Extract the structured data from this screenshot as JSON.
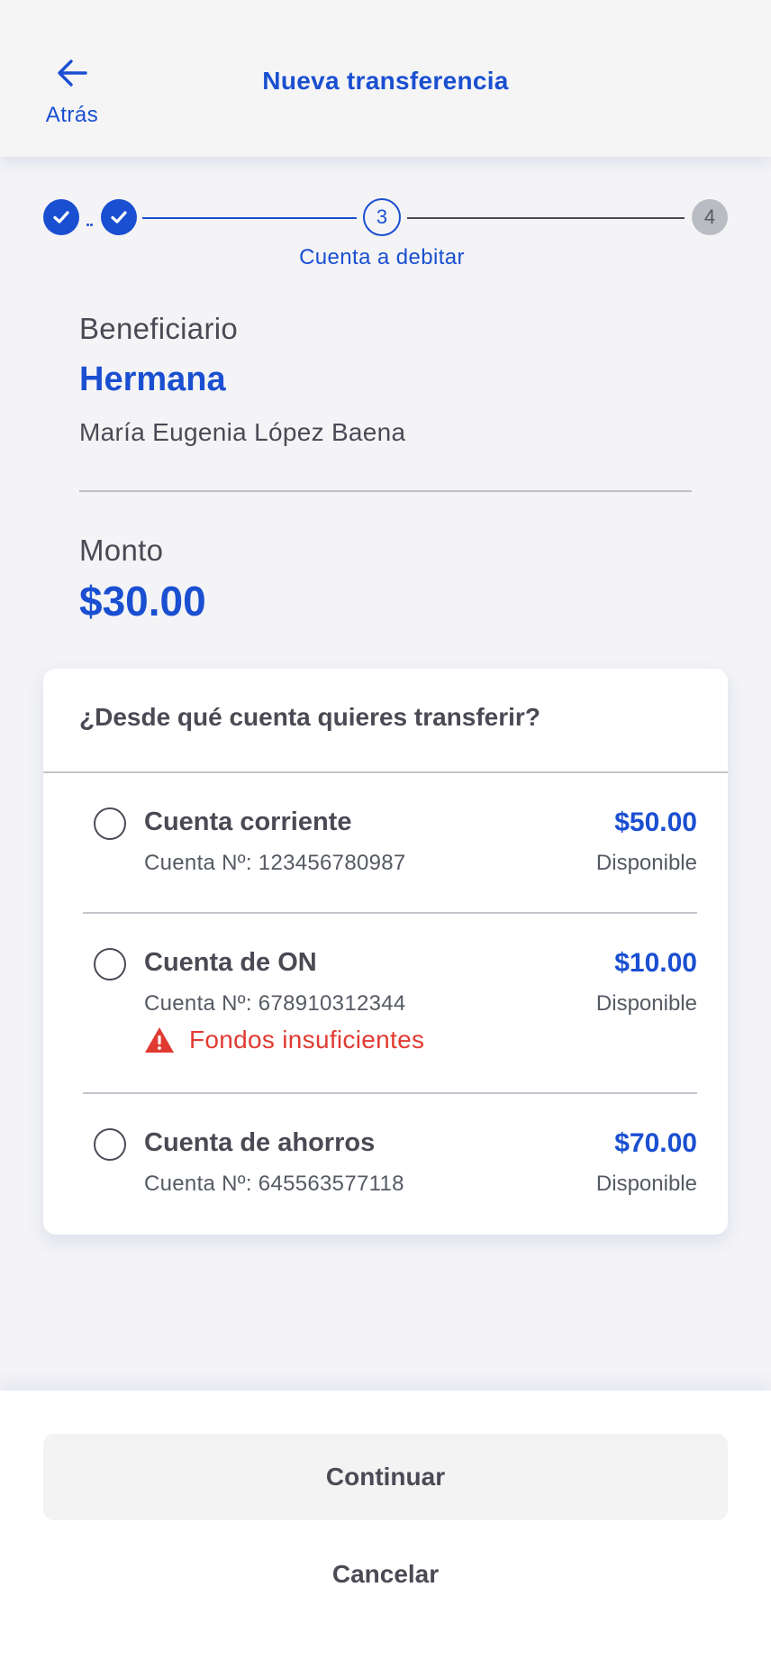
{
  "header": {
    "back_label": "Atrás",
    "back_icon": "arrow-left-icon",
    "title": "Nueva transferencia"
  },
  "stepper": {
    "current_step": "3",
    "pending_step": "4",
    "current_label": "Cuenta a debitar"
  },
  "beneficiary": {
    "caption": "Beneficiario",
    "alias": "Hermana",
    "name": "María Eugenia López Baena"
  },
  "amount": {
    "caption": "Monto",
    "value": "$30.00"
  },
  "accounts_card": {
    "question": "¿Desde qué cuenta quieres transferir?",
    "accounts": [
      {
        "name": "Cuenta corriente",
        "number": "Cuenta Nº: 123456780987",
        "balance": "$50.00",
        "available_label": "Disponible",
        "warning": ""
      },
      {
        "name": "Cuenta de ON",
        "number": "Cuenta Nº: 678910312344",
        "balance": "$10.00",
        "available_label": "Disponible",
        "warning": "Fondos insuficientes"
      },
      {
        "name": "Cuenta de ahorros",
        "number": "Cuenta Nº: 645563577118",
        "balance": "$70.00",
        "available_label": "Disponible",
        "warning": ""
      }
    ]
  },
  "footer": {
    "continue_label": "Continuar",
    "cancel_label": "Cancelar"
  },
  "colors": {
    "primary": "#1a4fd1",
    "text": "#4a4a55",
    "error": "#e03b32",
    "pending_step": "#b9bcc2"
  }
}
